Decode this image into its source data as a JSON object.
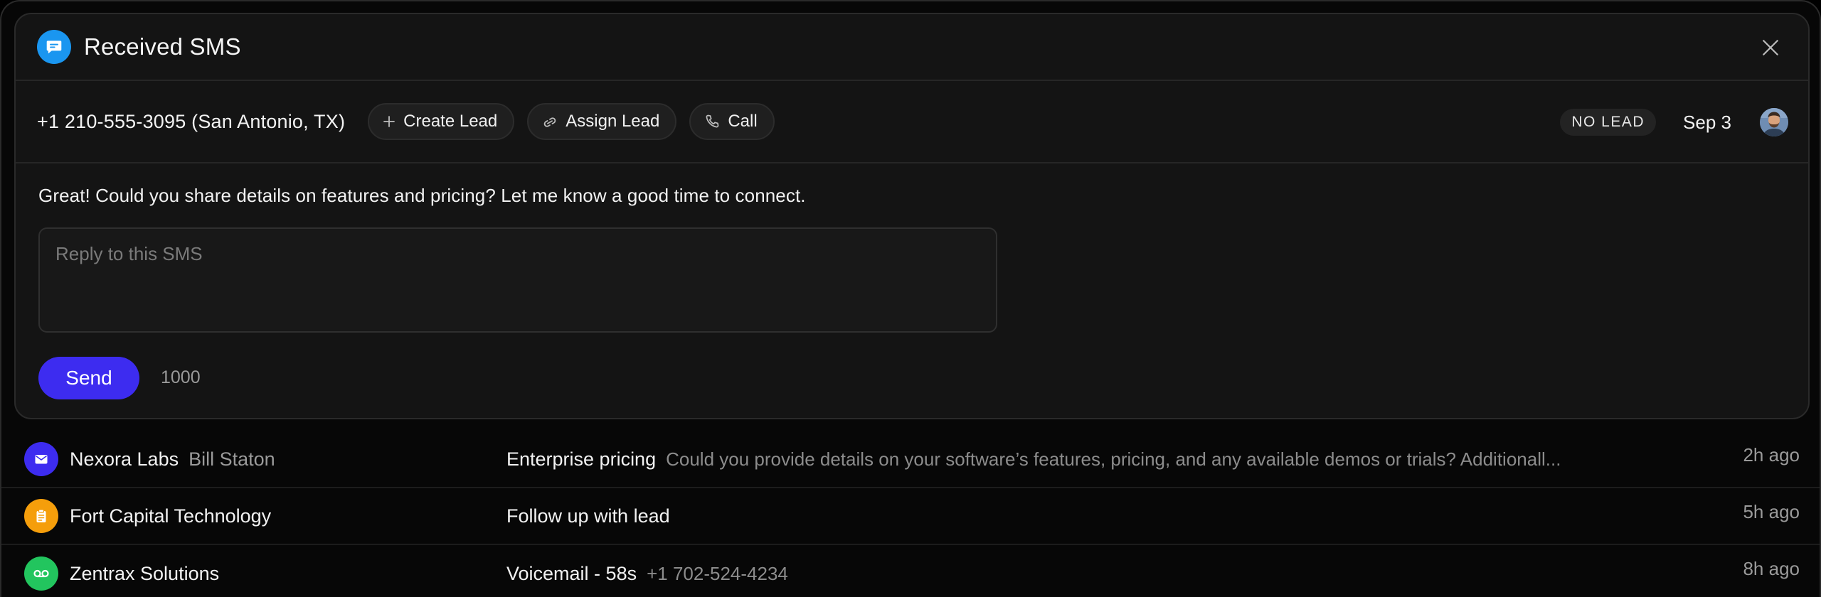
{
  "header": {
    "title": "Received SMS",
    "icon": "chat-bubble-icon",
    "icon_color": "#1a96f0"
  },
  "meta": {
    "phone": "+1 210-555-3095 (San Antonio, TX)",
    "actions": {
      "create_lead": "Create Lead",
      "assign_lead": "Assign Lead",
      "call": "Call"
    },
    "status_badge": "NO LEAD",
    "date": "Sep 3"
  },
  "message": {
    "text": "Great! Could you share details on features and pricing? Let me know a good time to connect."
  },
  "reply": {
    "placeholder": "Reply to this SMS",
    "value": "",
    "send_label": "Send",
    "char_count": "1000",
    "accent_color": "#3d2cf0"
  },
  "list": {
    "rows": [
      {
        "icon": "envelope-icon",
        "icon_color": "#3d2cf0",
        "company": "Nexora Labs",
        "contact": "Bill Staton",
        "subject": "Enterprise pricing",
        "preview": "Could you provide details on your software’s features, pricing, and any available demos or trials? Additionall...",
        "time": "2h ago"
      },
      {
        "icon": "clipboard-icon",
        "icon_color": "#f59e0b",
        "company": "Fort Capital Technology",
        "contact": "",
        "subject": "Follow up with lead",
        "preview": "",
        "time": "5h ago"
      },
      {
        "icon": "voicemail-icon",
        "icon_color": "#22c55e",
        "company": "Zentrax Solutions",
        "contact": "",
        "subject": "Voicemail - 58s",
        "preview": "+1 702-524-4234",
        "time": "8h ago"
      }
    ]
  }
}
